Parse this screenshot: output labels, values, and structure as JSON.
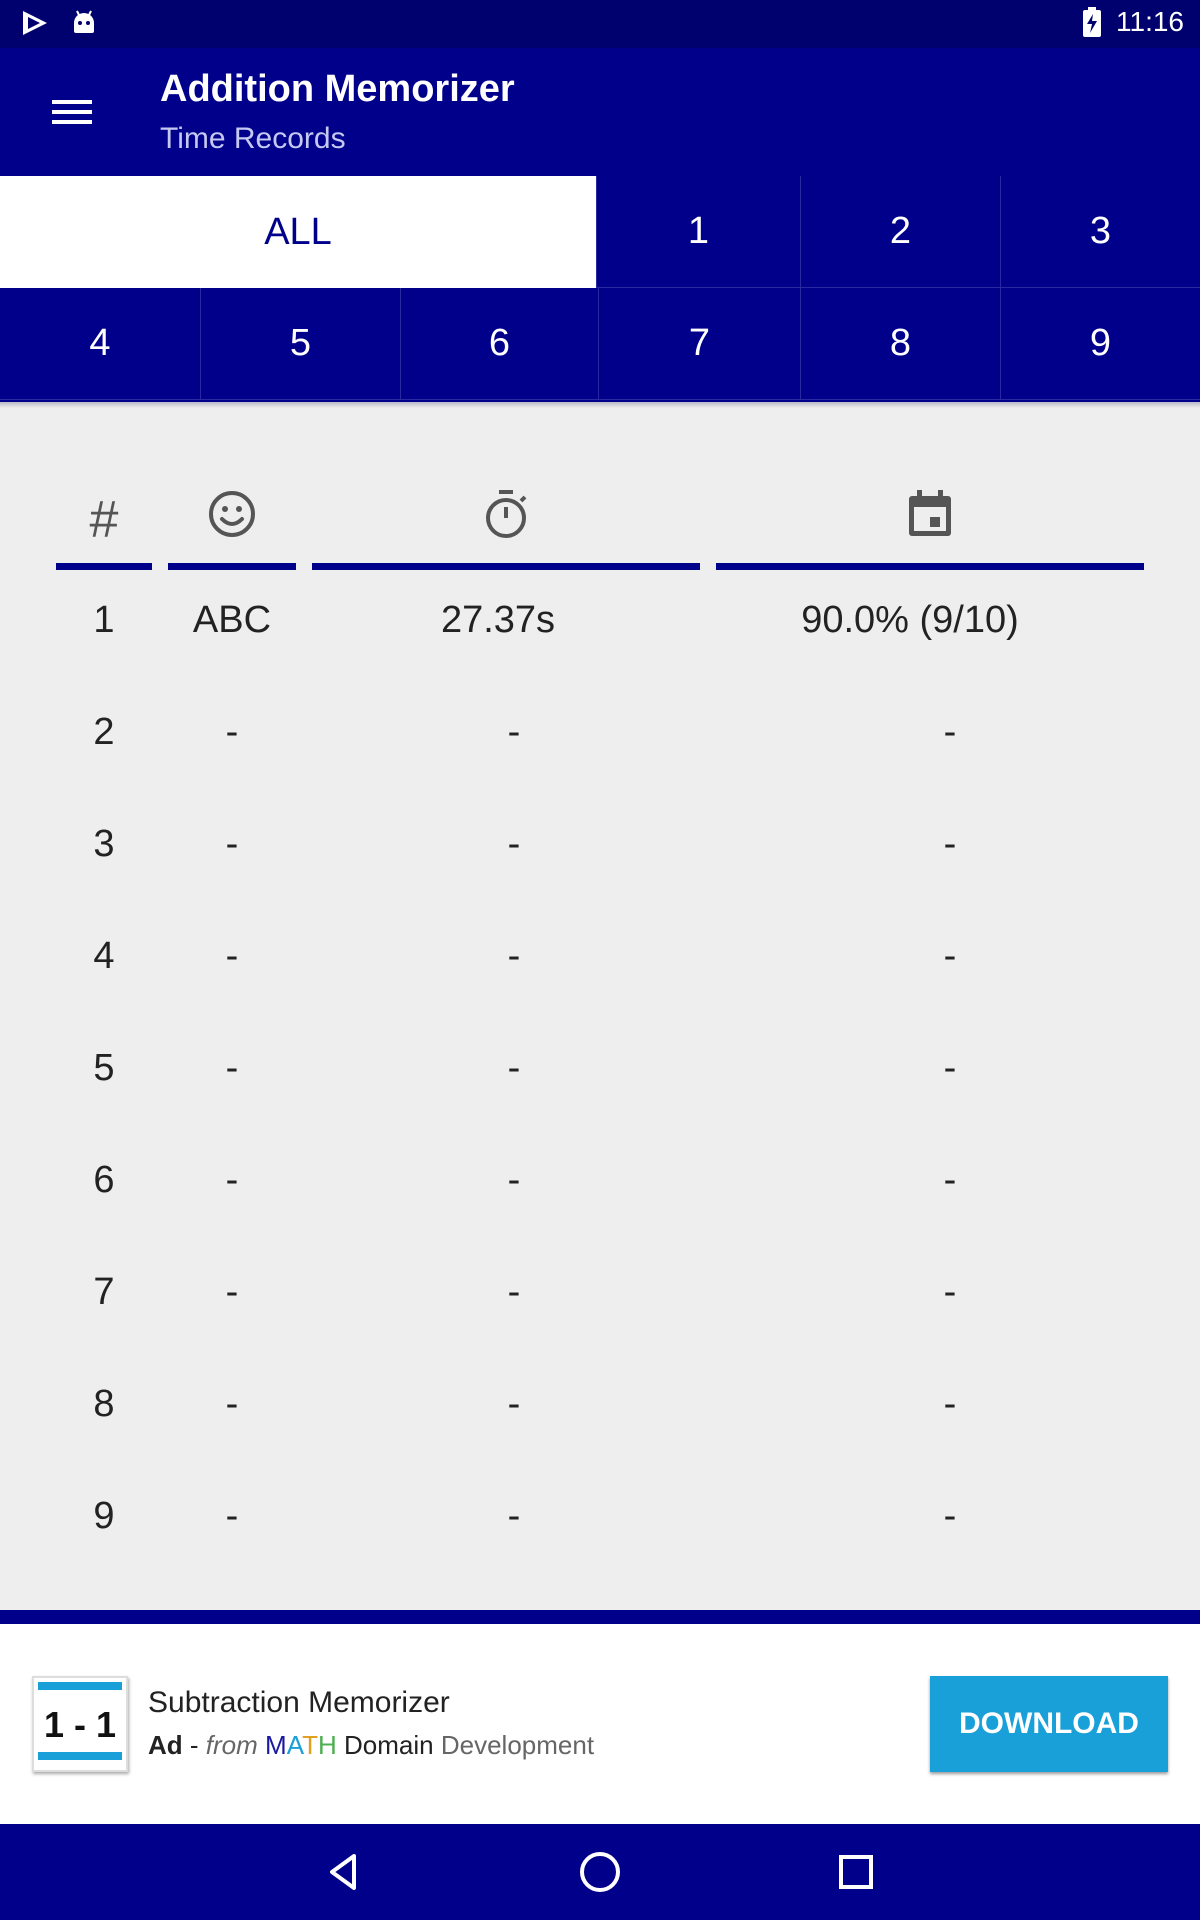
{
  "status_bar": {
    "time": "11:16",
    "icons": [
      "play-store-icon",
      "android-icon",
      "battery-charging-icon"
    ]
  },
  "app_bar": {
    "title": "Addition Memorizer",
    "subtitle": "Time Records",
    "menu_icon": "menu-icon"
  },
  "tabs": {
    "row1": [
      "ALL",
      "1",
      "2",
      "3"
    ],
    "row2": [
      "4",
      "5",
      "6",
      "7",
      "8",
      "9"
    ],
    "active": "ALL"
  },
  "table": {
    "headers": {
      "rank": "#",
      "name_icon": "smiley-icon",
      "time_icon": "stopwatch-icon",
      "date_icon": "calendar-icon"
    },
    "rows": [
      {
        "rank": "1",
        "name": "ABC",
        "time": "27.37s",
        "score": "90.0% (9/10)"
      },
      {
        "rank": "2",
        "name": "-",
        "time": "-",
        "score": "-"
      },
      {
        "rank": "3",
        "name": "-",
        "time": "-",
        "score": "-"
      },
      {
        "rank": "4",
        "name": "-",
        "time": "-",
        "score": "-"
      },
      {
        "rank": "5",
        "name": "-",
        "time": "-",
        "score": "-"
      },
      {
        "rank": "6",
        "name": "-",
        "time": "-",
        "score": "-"
      },
      {
        "rank": "7",
        "name": "-",
        "time": "-",
        "score": "-"
      },
      {
        "rank": "8",
        "name": "-",
        "time": "-",
        "score": "-"
      },
      {
        "rank": "9",
        "name": "-",
        "time": "-",
        "score": "-"
      }
    ]
  },
  "ad": {
    "logo_text": "1 - 1",
    "title": "Subtraction Memorizer",
    "ad_label": "Ad",
    "separator": " - ",
    "from_text": "from",
    "brand_letters": [
      "M",
      "A",
      "T",
      "H"
    ],
    "brand_colors": [
      "#1a1aa0",
      "#1aa0d8",
      "#e0a020",
      "#4caf50"
    ],
    "domain": "Domain",
    "developer": "Development",
    "button_label": "DOWNLOAD",
    "button_color": "#1aa0d8"
  },
  "nav_bar": {
    "icons": [
      "back-icon",
      "home-icon",
      "recents-icon"
    ]
  },
  "colors": {
    "primary": "#00008b",
    "status_bar": "#00006e",
    "background": "#eeeeee"
  }
}
